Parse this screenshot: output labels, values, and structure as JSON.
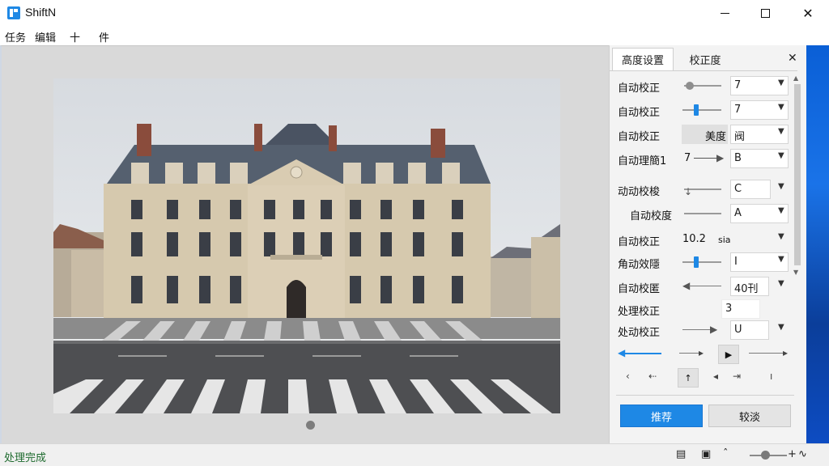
{
  "window": {
    "title": "ShiftN",
    "min_icon": "minimize-icon",
    "max_icon": "maximize-icon",
    "close_icon": "close-icon"
  },
  "menu": {
    "items": [
      "任务",
      "编辑",
      "十",
      "件"
    ]
  },
  "panel": {
    "tabs": [
      "高度设置",
      "校正度"
    ],
    "close_label": "✕",
    "rows": [
      {
        "label": "自动校正",
        "value": "7"
      },
      {
        "label": "自动校正",
        "value": "7"
      },
      {
        "label": "自动校正",
        "shade_text": "美度",
        "value": "阀"
      },
      {
        "label": "自动理簡1",
        "extra": "7",
        "value": "B"
      },
      {
        "label": "动动校梭",
        "value": "C"
      },
      {
        "label": "自动校度",
        "value": "A"
      },
      {
        "label": "自动校正",
        "extra": "10.2",
        "value": "sia"
      },
      {
        "label": "角动效隱",
        "value": "I"
      },
      {
        "label": "自动校匿",
        "value": "40刊"
      },
      {
        "label": "处理校正",
        "value": "3"
      },
      {
        "label": "处动校正",
        "value": "U"
      }
    ],
    "primary_button": "推荐",
    "secondary_button": "较淡"
  },
  "status": {
    "text": "处理完成",
    "zoom_plus": "+",
    "zoom_suffix": "∿"
  },
  "colors": {
    "accent": "#1e88e5",
    "status_green": "#1e6b2e"
  }
}
